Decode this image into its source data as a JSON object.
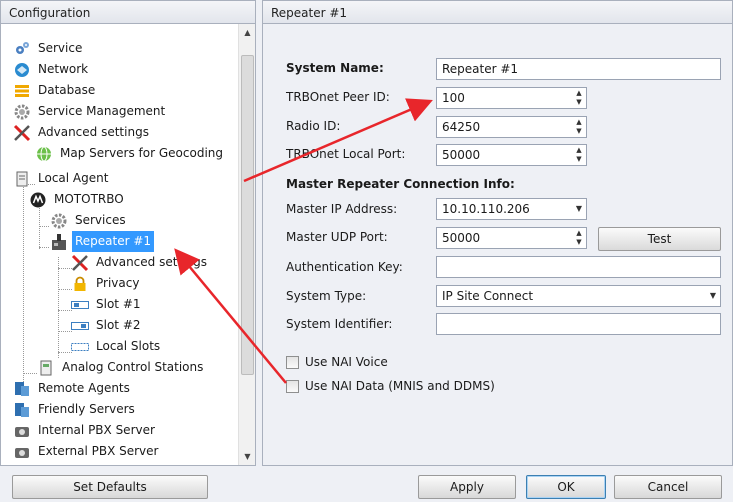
{
  "left_panel": {
    "title": "Configuration"
  },
  "tree": {
    "items": [
      {
        "label": "Service",
        "icon": "gears-icon"
      },
      {
        "label": "Network",
        "icon": "network-icon"
      },
      {
        "label": "Database",
        "icon": "database-icon"
      },
      {
        "label": "Service Management",
        "icon": "gear-icon"
      },
      {
        "label": "Advanced settings",
        "icon": "tools-icon"
      },
      {
        "label": "Map Servers for Geocoding",
        "icon": "globe-icon"
      },
      {
        "label": "Local Agent",
        "icon": "server-icon"
      },
      {
        "label": "MOTOTRBO",
        "icon": "motorola-logo-icon"
      },
      {
        "label": "Services",
        "icon": "gear-icon"
      },
      {
        "label": "Repeater #1",
        "icon": "repeater-icon",
        "selected": true
      },
      {
        "label": "Advanced settings",
        "icon": "tools-icon"
      },
      {
        "label": "Privacy",
        "icon": "lock-icon"
      },
      {
        "label": "Slot #1",
        "icon": "slot-icon"
      },
      {
        "label": "Slot #2",
        "icon": "slot-icon"
      },
      {
        "label": "Local Slots",
        "icon": "slot-icon"
      },
      {
        "label": "Analog Control Stations",
        "icon": "station-icon"
      },
      {
        "label": "Remote Agents",
        "icon": "agent-icon"
      },
      {
        "label": "Friendly Servers",
        "icon": "agent-icon"
      },
      {
        "label": "Internal PBX Server",
        "icon": "pbx-icon"
      },
      {
        "label": "External PBX Server",
        "icon": "pbx-icon"
      }
    ]
  },
  "right_panel": {
    "title": "Repeater #1",
    "system_name_label": "System Name:",
    "system_name_value": "Repeater #1",
    "peer_id_label": "TRBOnet Peer ID:",
    "peer_id_value": "100",
    "radio_id_label": "Radio ID:",
    "radio_id_value": "64250",
    "local_port_label": "TRBOnet Local Port:",
    "local_port_value": "50000",
    "master_section_label": "Master Repeater Connection Info:",
    "master_ip_label": "Master IP Address:",
    "master_ip_value": "10.10.110.206",
    "master_udp_label": "Master UDP Port:",
    "master_udp_value": "50000",
    "test_label": "Test",
    "auth_key_label": "Authentication Key:",
    "auth_key_value": "",
    "system_type_label": "System Type:",
    "system_type_value": "IP Site Connect",
    "system_identifier_label": "System Identifier:",
    "system_identifier_value": "",
    "nai_voice_label": "Use NAI Voice",
    "nai_voice_checked": false,
    "nai_data_label": "Use NAI Data (MNIS and DDMS)",
    "nai_data_checked": false
  },
  "bottom_bar": {
    "set_defaults_label": "Set Defaults",
    "apply_label": "Apply",
    "ok_label": "OK",
    "cancel_label": "Cancel"
  },
  "colors": {
    "selection": "#3399ff",
    "annotation_arrow": "#e8262b"
  }
}
